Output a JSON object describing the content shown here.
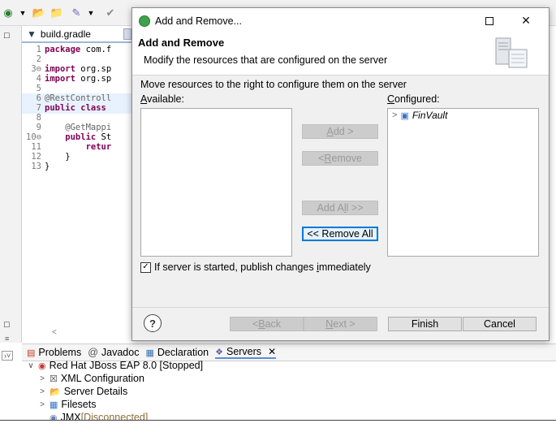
{
  "eclipse": {
    "editor_tab": "build.gradle",
    "code": [
      {
        "n": "1",
        "parts": [
          [
            "kw",
            "package"
          ],
          [
            "t",
            " com.f"
          ]
        ]
      },
      {
        "n": "2",
        "parts": [
          [
            "t",
            ""
          ]
        ]
      },
      {
        "n": "3⊖",
        "parts": [
          [
            "kw",
            "import"
          ],
          [
            "t",
            " org.sp"
          ]
        ]
      },
      {
        "n": "4",
        "parts": [
          [
            "kw",
            "import"
          ],
          [
            "t",
            " org.sp"
          ]
        ]
      },
      {
        "n": "5",
        "parts": [
          [
            "t",
            ""
          ]
        ]
      },
      {
        "n": "6",
        "parts": [
          [
            "ann",
            "@RestControll"
          ]
        ]
      },
      {
        "n": "7",
        "parts": [
          [
            "kw",
            "public class"
          ]
        ]
      },
      {
        "n": "8",
        "parts": [
          [
            "t",
            ""
          ]
        ]
      },
      {
        "n": "9",
        "parts": [
          [
            "ann",
            "    @GetMappi"
          ]
        ]
      },
      {
        "n": "10⊖",
        "parts": [
          [
            "kw",
            "    public"
          ],
          [
            "t",
            " St"
          ]
        ]
      },
      {
        "n": "11",
        "parts": [
          [
            "kw",
            "        retur"
          ]
        ]
      },
      {
        "n": "12",
        "parts": [
          [
            "t",
            "    }"
          ]
        ]
      },
      {
        "n": "13",
        "parts": [
          [
            "t",
            "}"
          ]
        ]
      }
    ],
    "bottom_tabs": [
      {
        "label": "Problems",
        "icon": "problems-icon"
      },
      {
        "label": "Javadoc",
        "icon": "javadoc-icon"
      },
      {
        "label": "Declaration",
        "icon": "declaration-icon"
      },
      {
        "label": "Servers",
        "icon": "servers-icon",
        "active": true
      }
    ],
    "server_tree": [
      {
        "label": "Red Hat JBoss EAP 8.0  [Stopped]",
        "level": 0,
        "arrow": "∨",
        "icon": "server-icon"
      },
      {
        "label": "XML Configuration",
        "level": 1,
        "arrow": ">",
        "icon": "xml-icon"
      },
      {
        "label": "Server Details",
        "level": 1,
        "arrow": ">",
        "icon": "folder-icon"
      },
      {
        "label": "Filesets",
        "level": 1,
        "arrow": ">",
        "icon": "fileset-icon"
      },
      {
        "label": "JMX",
        "suffix": "[Disconnected]",
        "level": 1,
        "arrow": "",
        "icon": "jmx-icon"
      }
    ]
  },
  "dialog": {
    "window_title": "Add and Remove...",
    "header_title": "Add and Remove",
    "header_subtitle": "Modify the resources that are configured on the server",
    "instruction": "Move resources to the right to configure them on the server",
    "available_label": "Available:",
    "configured_label": "Configured:",
    "configured_items": [
      "FinVault"
    ],
    "buttons": {
      "add": "Add >",
      "remove": "< Remove",
      "add_all": "Add All >>",
      "remove_all": "<< Remove All"
    },
    "publish_checkbox": {
      "label": "If server is started, publish changes immediately",
      "checked": true
    },
    "footer": {
      "back": "< Back",
      "next": "Next >",
      "finish": "Finish",
      "cancel": "Cancel"
    }
  }
}
